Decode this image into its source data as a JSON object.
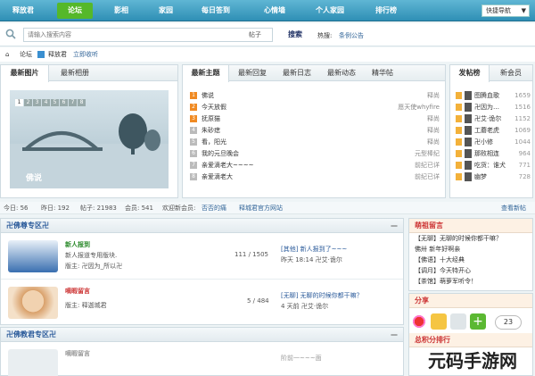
{
  "nav": {
    "items": [
      "释放君",
      "论坛",
      "影相",
      "家园",
      "每日答到",
      "心情墙",
      "个人家园",
      "排行榜"
    ],
    "active_index": 1,
    "quick_nav": "快捷导航"
  },
  "search": {
    "placeholder": "请输入搜索内容",
    "type": "帖子",
    "button": "搜索",
    "hot_label": "热搜:",
    "hot_link": "条例公告"
  },
  "breadcrumb": {
    "home": "论坛",
    "site": "释放君",
    "favorite": "立即收听"
  },
  "left_tabs": [
    "最新图片",
    "最新相册"
  ],
  "slide": {
    "numbers": [
      "1",
      "2",
      "3",
      "4",
      "5",
      "6",
      "7",
      "8"
    ],
    "caption": "佛说"
  },
  "mid_tabs": [
    "最新主题",
    "最新回复",
    "最新日志",
    "最新动态",
    "精华帖"
  ],
  "threads": [
    {
      "n": "1",
      "title": "佛说",
      "author": "释尚"
    },
    {
      "n": "2",
      "title": "今天放假",
      "author": "愿天使whyfire"
    },
    {
      "n": "3",
      "title": "抚原猫",
      "author": "释尚"
    },
    {
      "n": "4",
      "title": "朱砂痣",
      "author": "释尚"
    },
    {
      "n": "5",
      "title": "看，阳光",
      "author": "释尚"
    },
    {
      "n": "6",
      "title": "我的元旦晚会",
      "author": "元型棒纪"
    },
    {
      "n": "7",
      "title": "亲爱滴老大~~~~",
      "author": "前纪已详"
    },
    {
      "n": "8",
      "title": "亲爱滴老大",
      "author": "前纪已详"
    }
  ],
  "right_tabs": [
    "发帖榜",
    "新会员"
  ],
  "ranking": [
    {
      "name": "图腾血歌",
      "val": "1659"
    },
    {
      "name": "卍因为…",
      "val": "1516"
    },
    {
      "name": "卍艾·诡尔",
      "val": "1152"
    },
    {
      "name": "工蘑老虎",
      "val": "1069"
    },
    {
      "name": "卍小修",
      "val": "1044"
    },
    {
      "name": "那败相连",
      "val": "964"
    },
    {
      "name": "吃货：谁犬",
      "val": "771"
    },
    {
      "name": "幽梦",
      "val": "728"
    }
  ],
  "stats": {
    "today": "今日: 56",
    "yesterday": "昨日: 192",
    "posts": "帖子: 21983",
    "members": "会员: 541",
    "welcome": "欢迎新会员:",
    "newest": "否否的痛",
    "official": "释城君官方网站",
    "view_new": "查看新帖"
  },
  "forum1": {
    "head": "卍佛尊专区卍",
    "collapse": "—",
    "rows": [
      {
        "name": "新人报到",
        "desc": "新人报道专用版块.",
        "mod": "版主: 卍因为_所以卍",
        "count": "111 / 1505",
        "last": "[其他] 新人报到了~~~",
        "last2": "昨天 18:14 卍艾·诡尔"
      },
      {
        "name": "嘀暇留言",
        "desc": "",
        "mod": "版主: 释迦城君",
        "count": "5 / 484",
        "last": "[无聊] 无聊的时候你都干嘛？",
        "last2": "4 天前 卍艾·诡尔"
      }
    ]
  },
  "forum2": {
    "head": "卍佛教君专区卍",
    "collapse": "—",
    "row": {
      "name": "嘀暇留言",
      "count": "",
      "last": "阶前一~~~面"
    }
  },
  "side1": {
    "head": "萌祖留言",
    "items": [
      "【无聊】无聊的时候你都干嘛？",
      "佛卅 新年好啊亲",
      "【佛语】十大经典",
      "【调月】今天特开心",
      "【茶馆】萌萝军听令！"
    ]
  },
  "side2": {
    "head": "分享",
    "count": "23",
    "rank_head": "总积分排行"
  },
  "watermark": "元码手游网",
  "colors": {
    "nav": "#3a9cc2",
    "active": "#55b82a"
  }
}
